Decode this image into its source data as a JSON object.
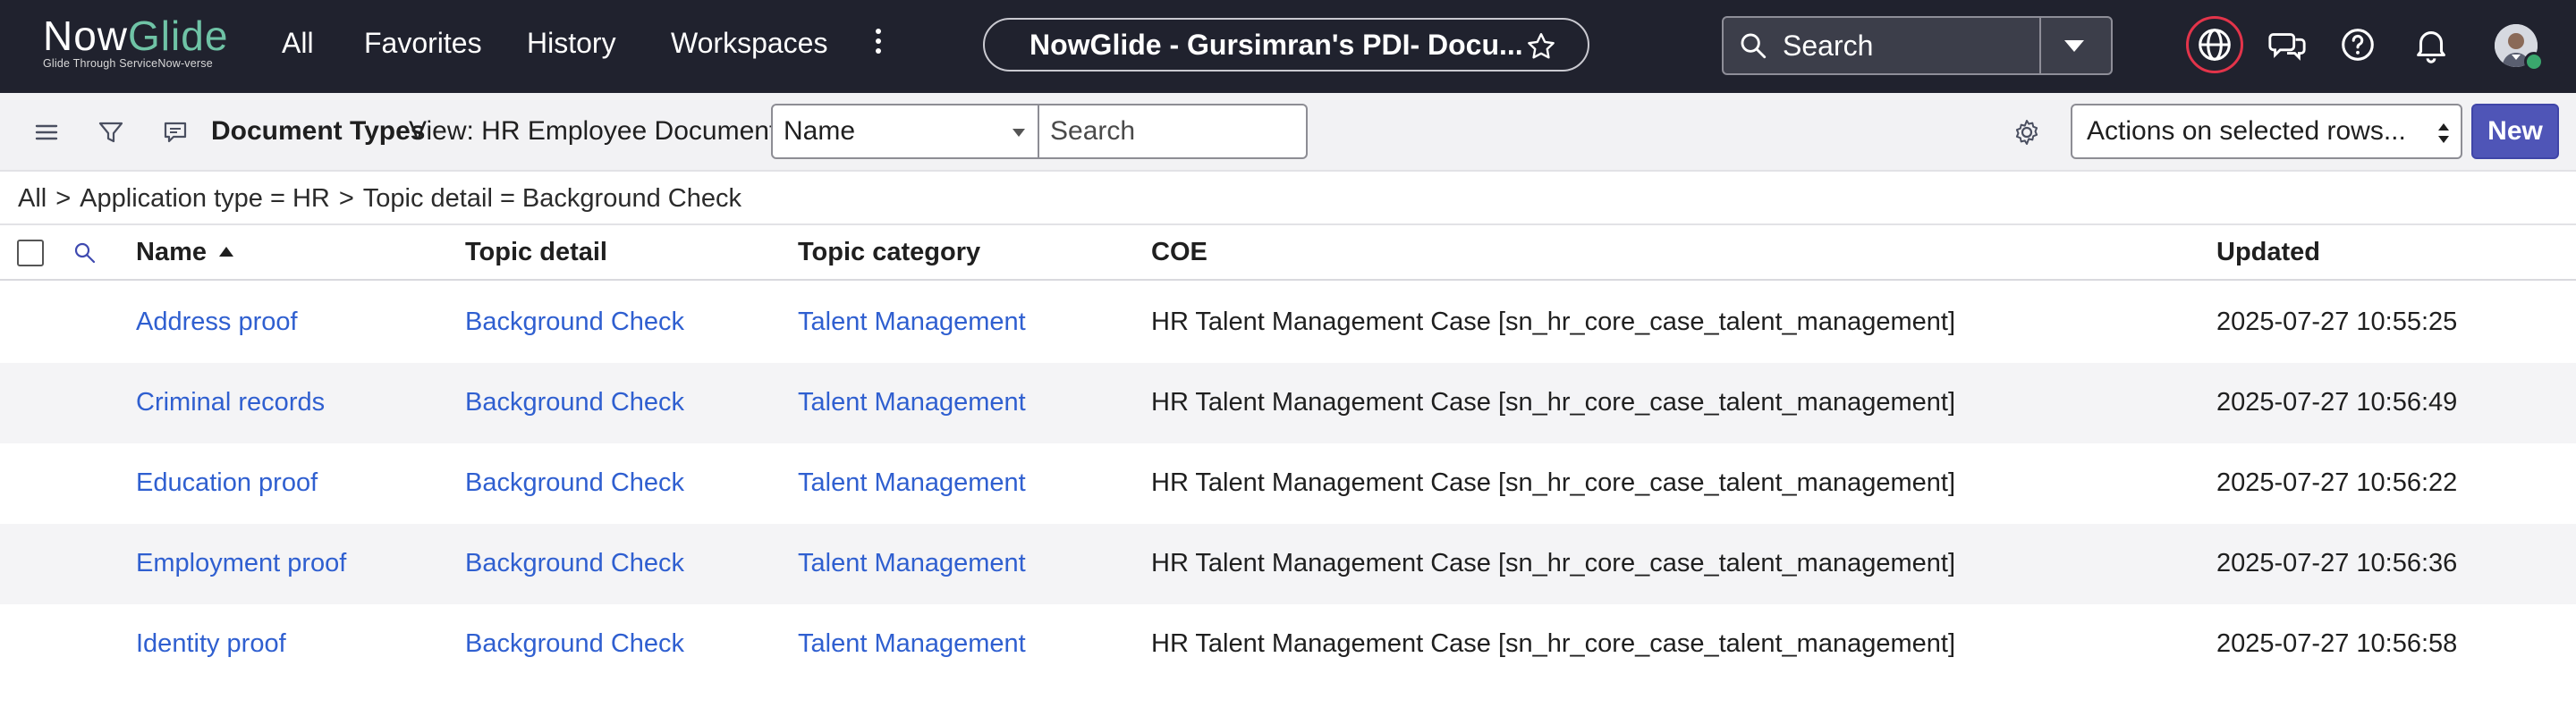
{
  "app": {
    "logo_part1": "Now",
    "logo_part2": "Glide",
    "tagline": "Glide Through ServiceNow-verse"
  },
  "nav": {
    "items": [
      "All",
      "Favorites",
      "History",
      "Workspaces"
    ],
    "record_title": "NowGlide - Gursimran's PDI- Docu...",
    "search_placeholder": "Search"
  },
  "toolbar": {
    "list_title": "Document Types",
    "view_label": "View: HR Employee Documents",
    "field_select_value": "Name",
    "list_search_placeholder": "Search",
    "actions_value": "Actions on selected rows...",
    "new_label": "New"
  },
  "breadcrumb": [
    "All",
    "Application type = HR",
    "Topic detail = Background Check"
  ],
  "table": {
    "columns": [
      "Name",
      "Topic detail",
      "Topic category",
      "COE",
      "Updated"
    ],
    "sort_column": "Name",
    "sort_direction": "ascending",
    "rows": [
      {
        "name": "Address proof",
        "topic_detail": "Background Check",
        "topic_category": "Talent Management",
        "coe": "HR Talent Management Case [sn_hr_core_case_talent_management]",
        "updated": "2025-07-27 10:55:25"
      },
      {
        "name": "Criminal records",
        "topic_detail": "Background Check",
        "topic_category": "Talent Management",
        "coe": "HR Talent Management Case [sn_hr_core_case_talent_management]",
        "updated": "2025-07-27 10:56:49"
      },
      {
        "name": "Education proof",
        "topic_detail": "Background Check",
        "topic_category": "Talent Management",
        "coe": "HR Talent Management Case [sn_hr_core_case_talent_management]",
        "updated": "2025-07-27 10:56:22"
      },
      {
        "name": "Employment proof",
        "topic_detail": "Background Check",
        "topic_category": "Talent Management",
        "coe": "HR Talent Management Case [sn_hr_core_case_talent_management]",
        "updated": "2025-07-27 10:56:36"
      },
      {
        "name": "Identity proof",
        "topic_detail": "Background Check",
        "topic_category": "Talent Management",
        "coe": "HR Talent Management Case [sn_hr_core_case_talent_management]",
        "updated": "2025-07-27 10:56:58"
      }
    ]
  },
  "colors": {
    "nav_bg": "#20222e",
    "link": "#2f5fd0",
    "primary_button": "#4f55b7",
    "logo_accent": "#6fc3a6",
    "highlight_ring": "#e3344a"
  },
  "icons": [
    "kebab-menu-icon",
    "star-icon",
    "search-icon",
    "chevron-down-icon",
    "globe-icon",
    "chat-icon",
    "help-icon",
    "bell-icon",
    "hamburger-menu-icon",
    "filter-icon",
    "comment-icon",
    "gear-icon",
    "sort-arrow-icon"
  ]
}
